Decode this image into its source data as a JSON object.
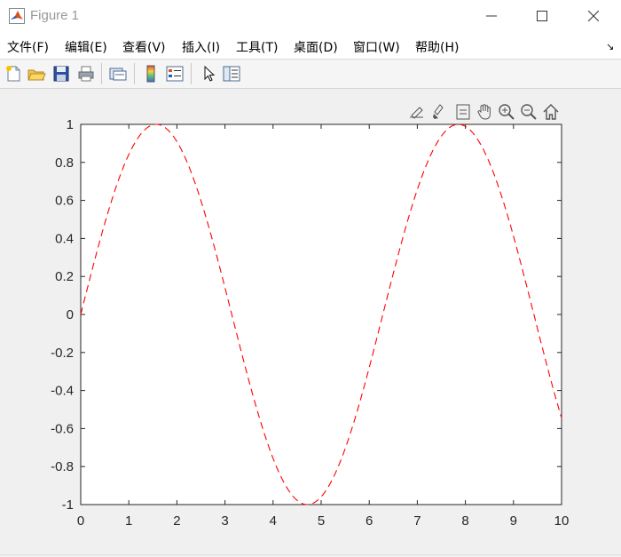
{
  "window": {
    "title": "Figure 1",
    "controls": [
      "minimize",
      "maximize",
      "close"
    ]
  },
  "menu": {
    "items": [
      {
        "label": "文件(F)"
      },
      {
        "label": "编辑(E)"
      },
      {
        "label": "查看(V)"
      },
      {
        "label": "插入(I)"
      },
      {
        "label": "工具(T)"
      },
      {
        "label": "桌面(D)"
      },
      {
        "label": "窗口(W)"
      },
      {
        "label": "帮助(H)"
      }
    ],
    "collapse_glyph": "↘"
  },
  "toolbar": {
    "buttons": [
      "new-figure-icon",
      "open-file-icon",
      "save-icon",
      "print-icon",
      "link-plot-icon",
      "insert-colorbar-icon",
      "insert-legend-icon",
      "edit-plot-icon",
      "property-inspector-icon"
    ]
  },
  "axes_toolbar": {
    "buttons": [
      "export-icon",
      "brush-icon",
      "data-tips-icon",
      "pan-icon",
      "zoom-in-icon",
      "zoom-out-icon",
      "home-icon"
    ]
  },
  "chart_data": {
    "type": "line",
    "title": "",
    "xlabel": "",
    "ylabel": "",
    "xlim": [
      0,
      10
    ],
    "ylim": [
      -1,
      1
    ],
    "xticks": [
      0,
      1,
      2,
      3,
      4,
      5,
      6,
      7,
      8,
      9,
      10
    ],
    "yticks": [
      -1,
      -0.8,
      -0.6,
      -0.4,
      -0.2,
      0,
      0.2,
      0.4,
      0.6,
      0.8,
      1
    ],
    "xtick_labels": [
      "0",
      "1",
      "2",
      "3",
      "4",
      "5",
      "6",
      "7",
      "8",
      "9",
      "10"
    ],
    "ytick_labels": [
      "-1",
      "-0.8",
      "-0.6",
      "-0.4",
      "-0.2",
      "0",
      "0.2",
      "0.4",
      "0.6",
      "0.8",
      "1"
    ],
    "grid": false,
    "series": [
      {
        "function": "sin(x)",
        "color": "#ff0000",
        "line_style": "dashed",
        "x": [
          0,
          0.5,
          1,
          1.5,
          1.5708,
          2,
          2.5,
          3,
          3.5,
          4,
          4.5,
          4.7124,
          5,
          5.5,
          6,
          6.5,
          7,
          7.5,
          7.854,
          8,
          8.5,
          9,
          9.5,
          10
        ],
        "y": [
          0,
          0.479,
          0.841,
          0.997,
          1,
          0.909,
          0.598,
          0.141,
          -0.351,
          -0.757,
          -0.978,
          -1,
          -0.959,
          -0.706,
          -0.279,
          0.215,
          0.657,
          0.938,
          1,
          0.989,
          0.798,
          0.412,
          -0.075,
          -0.544
        ]
      }
    ]
  }
}
